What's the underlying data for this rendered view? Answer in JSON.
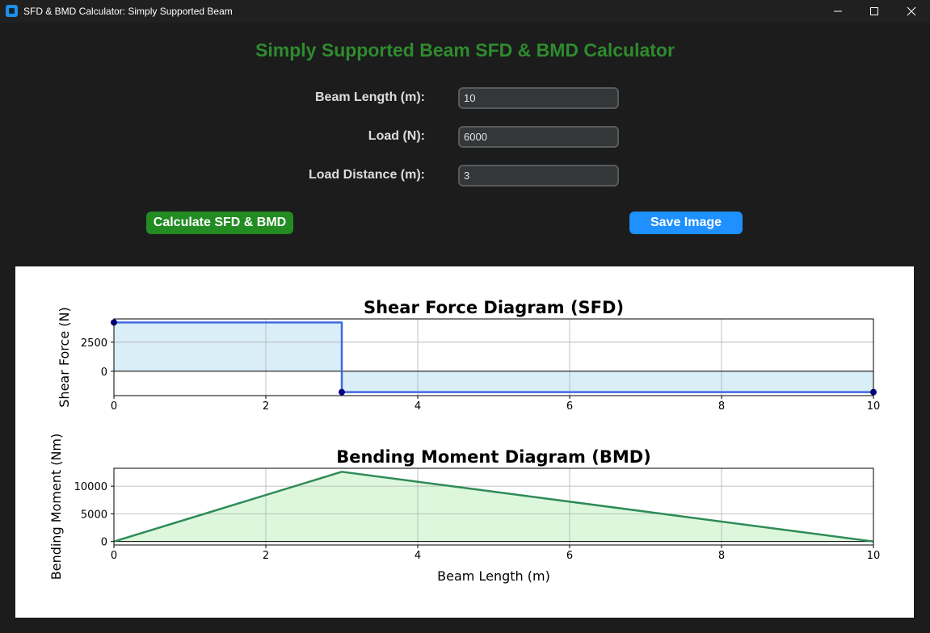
{
  "window": {
    "title": "SFD & BMD Calculator: Simply Supported Beam"
  },
  "app": {
    "heading": "Simply Supported Beam SFD & BMD Calculator"
  },
  "form": {
    "beam_length_label": "Beam Length (m):",
    "beam_length_value": "10",
    "load_label": "Load (N):",
    "load_value": "6000",
    "load_distance_label": "Load Distance (m):",
    "load_distance_value": "3"
  },
  "buttons": {
    "calculate_label": "Calculate SFD & BMD",
    "save_label": "Save Image"
  },
  "colors": {
    "heading": "#2e8b2e",
    "calculate_button": "#228b22",
    "save_button": "#1e90ff",
    "sfd_line": "#4169e1",
    "sfd_fill": "#d9eef7",
    "sfd_marker": "#00008b",
    "bmd_line": "#2e8b57",
    "bmd_fill": "#dcf7dc"
  },
  "chart_data": [
    {
      "type": "line",
      "title": "Shear Force Diagram (SFD)",
      "xlabel": "",
      "ylabel": "Shear Force (N)",
      "x": [
        0,
        3,
        3,
        10
      ],
      "y": [
        4200,
        4200,
        -1800,
        -1800
      ],
      "markers": {
        "x": [
          0,
          3,
          10
        ],
        "y": [
          4200,
          -1800,
          -1800
        ]
      },
      "xlim": [
        0,
        10
      ],
      "ylim": [
        -2100,
        4500
      ],
      "xticks": [
        0,
        2,
        4,
        6,
        8,
        10
      ],
      "yticks": [
        0,
        2500
      ],
      "fill": "to-zero",
      "grid": true,
      "zero_line": true
    },
    {
      "type": "area",
      "title": "Bending Moment Diagram (BMD)",
      "xlabel": "Beam Length (m)",
      "ylabel": "Bending Moment (Nm)",
      "x": [
        0,
        3,
        10
      ],
      "y": [
        0,
        12600,
        0
      ],
      "xlim": [
        0,
        10
      ],
      "ylim": [
        -630,
        13230
      ],
      "xticks": [
        0,
        2,
        4,
        6,
        8,
        10
      ],
      "yticks": [
        0,
        5000,
        10000
      ],
      "fill": "to-zero",
      "grid": true,
      "zero_line": true
    }
  ]
}
